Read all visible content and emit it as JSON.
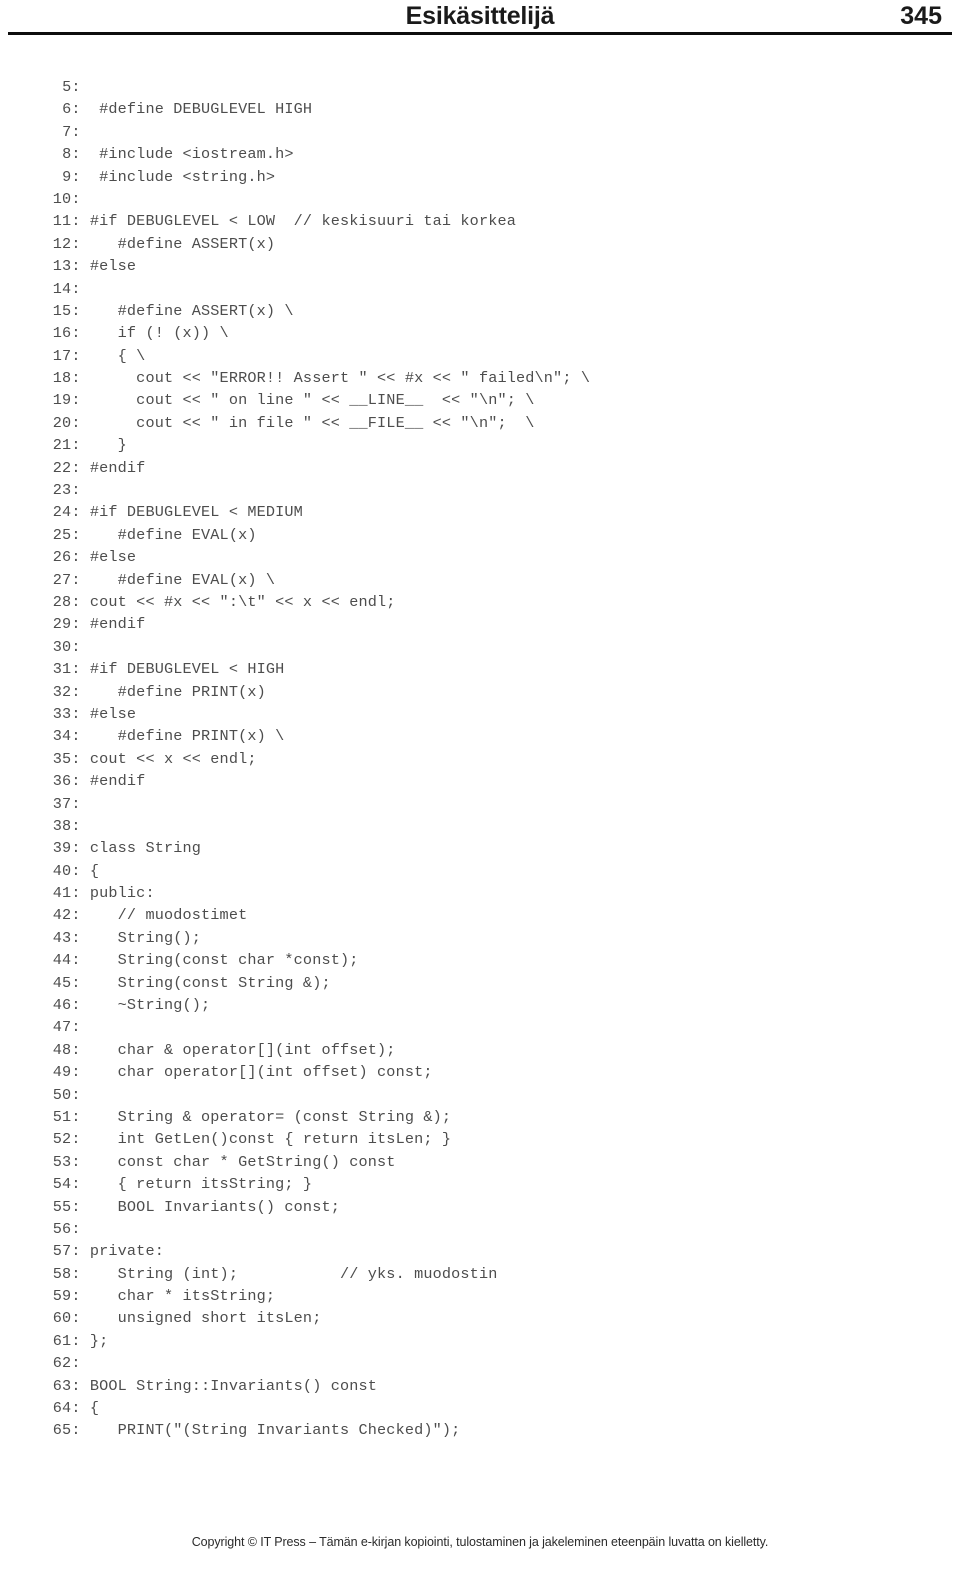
{
  "header": {
    "title": "Esikäsittelijä",
    "page_number": "345"
  },
  "footer": {
    "copyright": "Copyright © IT Press – Tämän e-kirjan kopiointi, tulostaminen ja jakeleminen eteenpäin luvatta on kielletty."
  },
  "code": {
    "language": "cpp",
    "lines": [
      {
        "n": "5",
        "text": ""
      },
      {
        "n": "6",
        "text": "  #define DEBUGLEVEL HIGH"
      },
      {
        "n": "7",
        "text": ""
      },
      {
        "n": "8",
        "text": "  #include <iostream.h>"
      },
      {
        "n": "9",
        "text": "  #include <string.h>"
      },
      {
        "n": "10",
        "text": ""
      },
      {
        "n": "11",
        "text": " #if DEBUGLEVEL < LOW  // keskisuuri tai korkea"
      },
      {
        "n": "12",
        "text": "    #define ASSERT(x)"
      },
      {
        "n": "13",
        "text": " #else"
      },
      {
        "n": "14",
        "text": ""
      },
      {
        "n": "15",
        "text": "    #define ASSERT(x) \\"
      },
      {
        "n": "16",
        "text": "    if (! (x)) \\"
      },
      {
        "n": "17",
        "text": "    { \\"
      },
      {
        "n": "18",
        "text": "      cout << \"ERROR!! Assert \" << #x << \" failed\\n\"; \\"
      },
      {
        "n": "19",
        "text": "      cout << \" on line \" << __LINE__  << \"\\n\"; \\"
      },
      {
        "n": "20",
        "text": "      cout << \" in file \" << __FILE__ << \"\\n\";  \\"
      },
      {
        "n": "21",
        "text": "    }"
      },
      {
        "n": "22",
        "text": " #endif"
      },
      {
        "n": "23",
        "text": ""
      },
      {
        "n": "24",
        "text": " #if DEBUGLEVEL < MEDIUM"
      },
      {
        "n": "25",
        "text": "    #define EVAL(x)"
      },
      {
        "n": "26",
        "text": " #else"
      },
      {
        "n": "27",
        "text": "    #define EVAL(x) \\"
      },
      {
        "n": "28",
        "text": " cout << #x << \":\\t\" << x << endl;"
      },
      {
        "n": "29",
        "text": " #endif"
      },
      {
        "n": "30",
        "text": ""
      },
      {
        "n": "31",
        "text": " #if DEBUGLEVEL < HIGH"
      },
      {
        "n": "32",
        "text": "    #define PRINT(x)"
      },
      {
        "n": "33",
        "text": " #else"
      },
      {
        "n": "34",
        "text": "    #define PRINT(x) \\"
      },
      {
        "n": "35",
        "text": " cout << x << endl;"
      },
      {
        "n": "36",
        "text": " #endif"
      },
      {
        "n": "37",
        "text": ""
      },
      {
        "n": "38",
        "text": ""
      },
      {
        "n": "39",
        "text": " class String"
      },
      {
        "n": "40",
        "text": " {"
      },
      {
        "n": "41",
        "text": " public:"
      },
      {
        "n": "42",
        "text": "    // muodostimet"
      },
      {
        "n": "43",
        "text": "    String();"
      },
      {
        "n": "44",
        "text": "    String(const char *const);"
      },
      {
        "n": "45",
        "text": "    String(const String &);"
      },
      {
        "n": "46",
        "text": "    ~String();"
      },
      {
        "n": "47",
        "text": ""
      },
      {
        "n": "48",
        "text": "    char & operator[](int offset);"
      },
      {
        "n": "49",
        "text": "    char operator[](int offset) const;"
      },
      {
        "n": "50",
        "text": ""
      },
      {
        "n": "51",
        "text": "    String & operator= (const String &);"
      },
      {
        "n": "52",
        "text": "    int GetLen()const { return itsLen; }"
      },
      {
        "n": "53",
        "text": "    const char * GetString() const"
      },
      {
        "n": "54",
        "text": "    { return itsString; }"
      },
      {
        "n": "55",
        "text": "    BOOL Invariants() const;"
      },
      {
        "n": "56",
        "text": ""
      },
      {
        "n": "57",
        "text": " private:"
      },
      {
        "n": "58",
        "text": "    String (int);           // yks. muodostin"
      },
      {
        "n": "59",
        "text": "    char * itsString;"
      },
      {
        "n": "60",
        "text": "    unsigned short itsLen;"
      },
      {
        "n": "61",
        "text": " };"
      },
      {
        "n": "62",
        "text": ""
      },
      {
        "n": "63",
        "text": " BOOL String::Invariants() const"
      },
      {
        "n": "64",
        "text": " {"
      },
      {
        "n": "65",
        "text": "    PRINT(\"(String Invariants Checked)\");"
      }
    ]
  }
}
